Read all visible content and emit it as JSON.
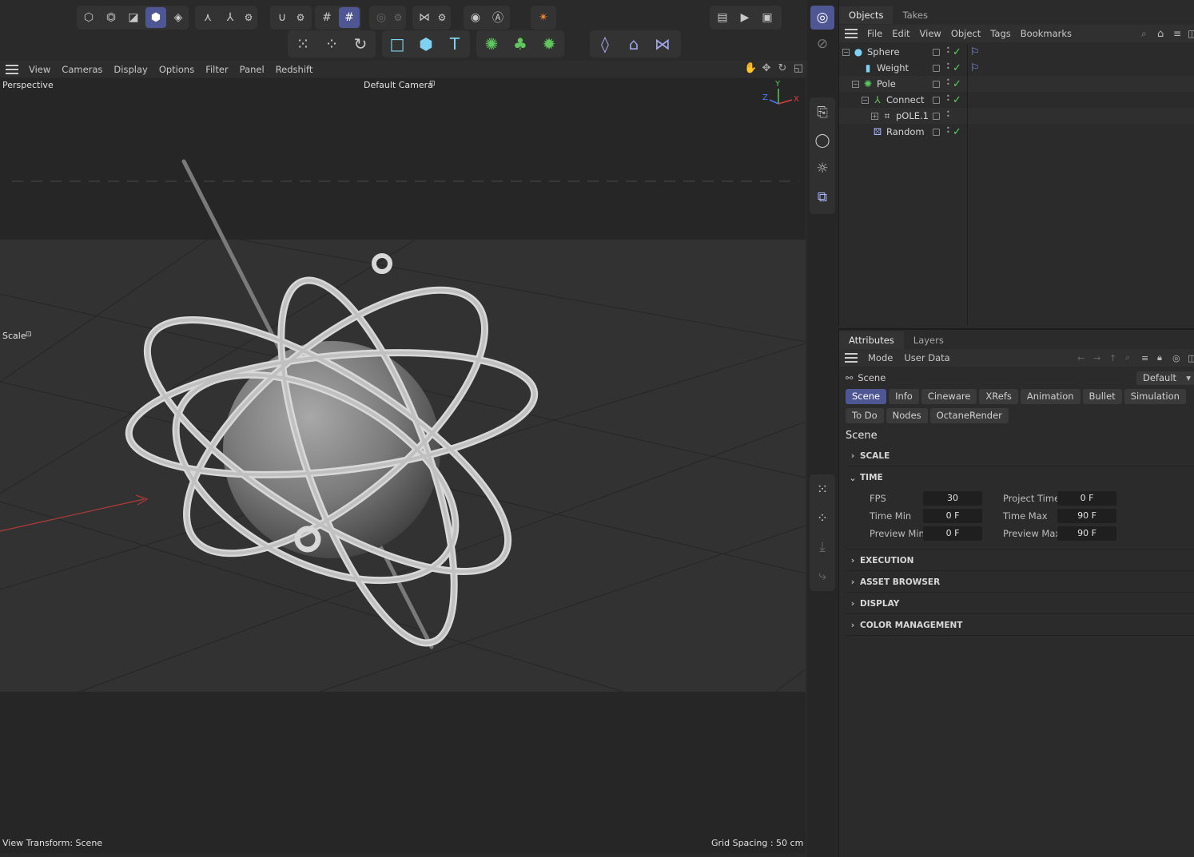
{
  "colors": {
    "accent": "#4e5794",
    "check_green": "#5cd35c",
    "axis_red": "#d74040",
    "axis_green": "#4fcf4f",
    "axis_blue": "#4f7fff"
  },
  "toolbar": {
    "row1_icons": [
      "undo-icon",
      "make-editable-icon",
      "model-mode-icon",
      "object-mode-icon",
      "point-mode-icon",
      "axis-icon",
      "locked-workplane-icon",
      "settings-icon",
      "snap-icon",
      "snap-settings-icon",
      "grid-icon",
      "grid-snap-icon",
      "solo-icon",
      "solo-settings-icon",
      "symmetry-icon",
      "symmetry-settings-icon",
      "viewport-solo-icon",
      "auto-icon",
      "render-region-icon",
      "clapper-icon",
      "render-icon",
      "render-settings-icon"
    ],
    "row2_icons": [
      "move-tool-icon",
      "scale-tool-icon",
      "rotate-tool-icon",
      "cube-icon",
      "sphere-solid-icon",
      "text-icon",
      "cloner-icon",
      "mograph-icon",
      "effector-icon",
      "tag-icon",
      "spline-icon",
      "deformer-icon"
    ]
  },
  "viewport": {
    "menu": [
      "View",
      "Cameras",
      "Display",
      "Options",
      "Filter",
      "Panel",
      "Redshift"
    ],
    "view_name": "Perspective",
    "camera": "Default Camera",
    "hud_label": "Scale",
    "view_transform": "View Transform: Scene",
    "grid_spacing": "Grid Spacing : 50 cm",
    "axis": {
      "x": "X",
      "y": "Y",
      "z": "Z"
    }
  },
  "objects": {
    "tabs": [
      "Objects",
      "Takes"
    ],
    "menu": [
      "File",
      "Edit",
      "View",
      "Object",
      "Tags",
      "Bookmarks"
    ],
    "tree": [
      {
        "name": "Sphere",
        "icon": "sphere-icon",
        "tag": "true",
        "check": "true"
      },
      {
        "name": "Weight",
        "icon": "cylinder-icon",
        "tag": "true",
        "check": "true"
      },
      {
        "name": "Pole",
        "icon": "cloner-icon",
        "tag": "false",
        "check": "true"
      },
      {
        "name": "Connect",
        "icon": "connect-icon",
        "tag": "false",
        "check": "true"
      },
      {
        "name": "pOLE.1",
        "icon": "polygon-object-icon",
        "tag": "false",
        "check": "false"
      },
      {
        "name": "Random",
        "icon": "random-effector-icon",
        "tag": "false",
        "check": "true"
      }
    ]
  },
  "attributes": {
    "tabs": [
      "Attributes",
      "Layers"
    ],
    "menu": [
      "Mode",
      "User Data"
    ],
    "scene_label": "Scene",
    "preset": "Default",
    "chips": [
      "Scene",
      "Info",
      "Cineware",
      "XRefs",
      "Animation",
      "Bullet",
      "Simulation",
      "To Do",
      "Nodes",
      "OctaneRender"
    ],
    "section": "Scene",
    "groups": [
      "SCALE",
      "TIME",
      "EXECUTION",
      "ASSET BROWSER",
      "DISPLAY",
      "COLOR MANAGEMENT"
    ],
    "time": {
      "fps_label": "FPS",
      "fps": "30",
      "project_time_label": "Project Time",
      "project_time": "0 F",
      "time_min_label": "Time Min",
      "time_min": "0 F",
      "time_max_label": "Time Max",
      "time_max": "90 F",
      "preview_min_label": "Preview Min",
      "preview_min": "0 F",
      "preview_max_label": "Preview Max",
      "preview_max": "90 F"
    }
  }
}
